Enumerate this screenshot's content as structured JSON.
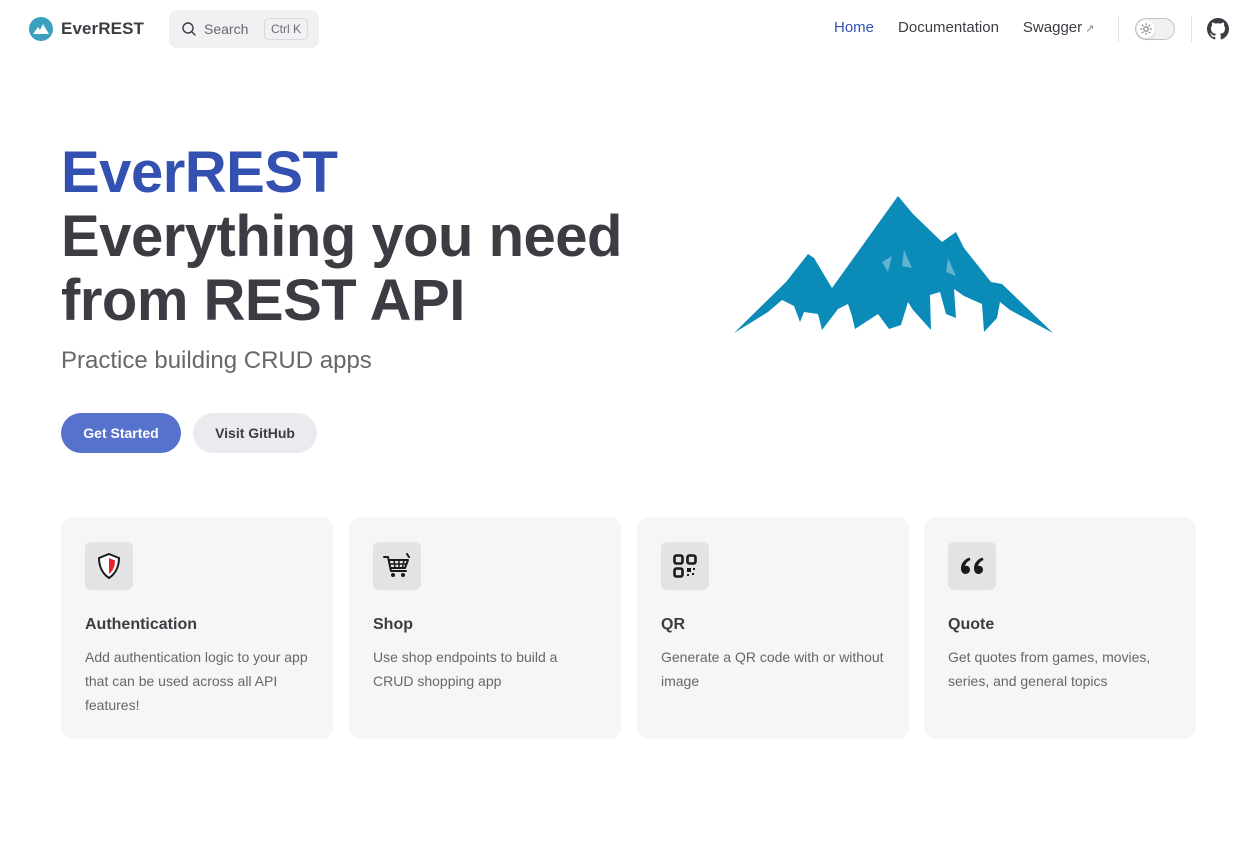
{
  "nav": {
    "brand": "EverREST",
    "search_label": "Search",
    "search_shortcut": "Ctrl K",
    "links": [
      {
        "label": "Home",
        "active": true
      },
      {
        "label": "Documentation",
        "active": false
      },
      {
        "label": "Swagger",
        "external": true
      }
    ],
    "theme_toggle_icon": "sun-icon",
    "github_icon": "github-icon"
  },
  "hero": {
    "name": "EverREST",
    "text": "Everything you need from REST API",
    "tagline": "Practice building CRUD apps",
    "actions": [
      {
        "label": "Get Started",
        "theme": "brand"
      },
      {
        "label": "Visit GitHub",
        "theme": "alt"
      }
    ],
    "image_icon": "mountain-icon"
  },
  "features": [
    {
      "icon": "shield-icon",
      "title": "Authentication",
      "details": "Add authentication logic to your app that can be used across all API features!"
    },
    {
      "icon": "shopping-cart-icon",
      "title": "Shop",
      "details": "Use shop endpoints to build a CRUD shopping app"
    },
    {
      "icon": "qr-code-icon",
      "title": "QR",
      "details": "Generate a QR code with or without image"
    },
    {
      "icon": "quote-icon",
      "title": "Quote",
      "details": "Get quotes from games, movies, series, and general topics"
    }
  ],
  "colors": {
    "brand": "#3451b2",
    "button_primary": "#5672cd",
    "mountain": "#0b8bb8",
    "text": "#3c3c43",
    "muted": "#67676c"
  }
}
